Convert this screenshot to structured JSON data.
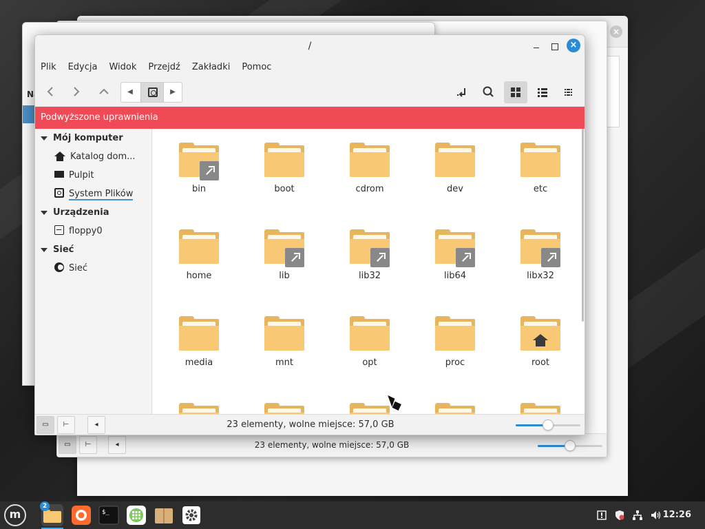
{
  "window": {
    "title": "/",
    "close_glyph": "×"
  },
  "menubar": {
    "items": [
      "Plik",
      "Edycja",
      "Widok",
      "Przejdź",
      "Zakładki",
      "Pomoc"
    ]
  },
  "banner": {
    "text": "Podwyższone uprawnienia",
    "color": "#ef4a56"
  },
  "sidebar": {
    "sections": [
      {
        "title": "Mój komputer",
        "items": [
          {
            "label": "Katalog dom...",
            "icon": "home-icon"
          },
          {
            "label": "Pulpit",
            "icon": "desktop-icon"
          },
          {
            "label": "System Plików",
            "icon": "filesystem-icon",
            "selected": true
          }
        ]
      },
      {
        "title": "Urządzenia",
        "items": [
          {
            "label": "floppy0",
            "icon": "floppy-icon"
          }
        ]
      },
      {
        "title": "Sieć",
        "items": [
          {
            "label": "Sieć",
            "icon": "network-icon"
          }
        ]
      }
    ]
  },
  "files": [
    {
      "name": "bin",
      "link": true
    },
    {
      "name": "boot",
      "link": false
    },
    {
      "name": "cdrom",
      "link": false
    },
    {
      "name": "dev",
      "link": false
    },
    {
      "name": "etc",
      "link": false
    },
    {
      "name": "home",
      "link": false
    },
    {
      "name": "lib",
      "link": true
    },
    {
      "name": "lib32",
      "link": true
    },
    {
      "name": "lib64",
      "link": true
    },
    {
      "name": "libx32",
      "link": true
    },
    {
      "name": "media",
      "link": false
    },
    {
      "name": "mnt",
      "link": false
    },
    {
      "name": "opt",
      "link": false
    },
    {
      "name": "proc",
      "link": false
    },
    {
      "name": "root",
      "link": false,
      "home_emblem": true
    }
  ],
  "statusbar": {
    "text": "23 elementy, wolne miejsce: 57,0 GB",
    "zoom_fraction": 0.5
  },
  "back_window": {
    "status_text": "23 elementy, wolne miejsce: 57,0 GB",
    "sidebar_header_fragment": "Na"
  },
  "taskbar": {
    "clock": "12:26",
    "workspace_badge": "2",
    "apps": [
      "file-manager-icon",
      "firefox-icon",
      "terminal-icon",
      "update-manager-icon",
      "archive-icon",
      "settings-icon"
    ],
    "accent": "#2b8cd6"
  }
}
